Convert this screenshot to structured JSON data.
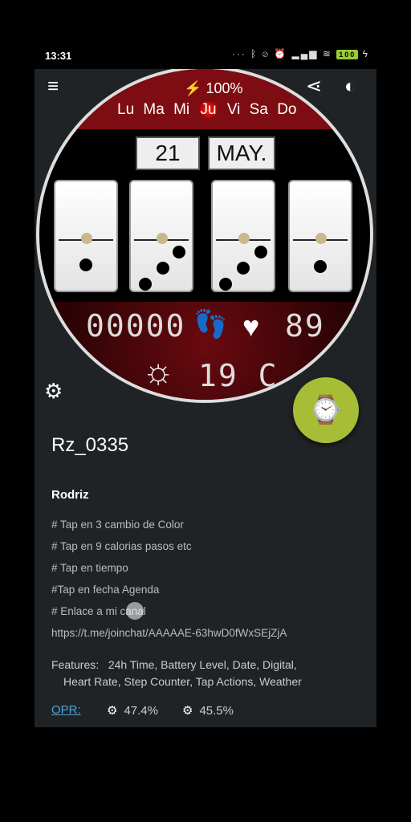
{
  "status": {
    "time": "13:31",
    "icons": [
      "signal-dots",
      "bluetooth-icon",
      "mute-icon",
      "alarm-icon",
      "signal-icon",
      "wifi-icon",
      "battery-icon",
      "charging-icon"
    ],
    "battery": "100"
  },
  "toolbar": {
    "menu_icon": "≡",
    "share_icon": "share-icon",
    "theme_icon": "theme-toggle-icon"
  },
  "watchface": {
    "battery_text": "100%",
    "days": [
      "Lu",
      "Ma",
      "Mi",
      "Ju",
      "Vi",
      "Sa",
      "Do"
    ],
    "active_day": "Ju",
    "day_number": "21",
    "month": "MAY.",
    "steps": "00000",
    "heart_rate": "89",
    "temperature": "19 C"
  },
  "watch": {
    "title": "Rz_0335",
    "author": "Rodriz",
    "description": [
      "# Tap en 3 cambio de Color",
      "# Tap en 9 calorias pasos etc",
      "# Tap en tiempo",
      "#Tap en fecha Agenda",
      "# Enlace a mi canal",
      "https://t.me/joinchat/AAAAAE-63hwD0fWxSEjZjA"
    ],
    "features_label": "Features:",
    "features_line1": "24h Time,  Battery Level,  Date,  Digital,",
    "features_line2": "Heart Rate,  Step Counter,  Tap Actions,  Weather",
    "opr_label": "OPR:",
    "stat1": "47.4%",
    "stat2": "45.5%"
  },
  "colors": {
    "accent_green": "#a7bd35",
    "link_blue": "#4ba3d4",
    "watch_red": "#7d0d12"
  }
}
